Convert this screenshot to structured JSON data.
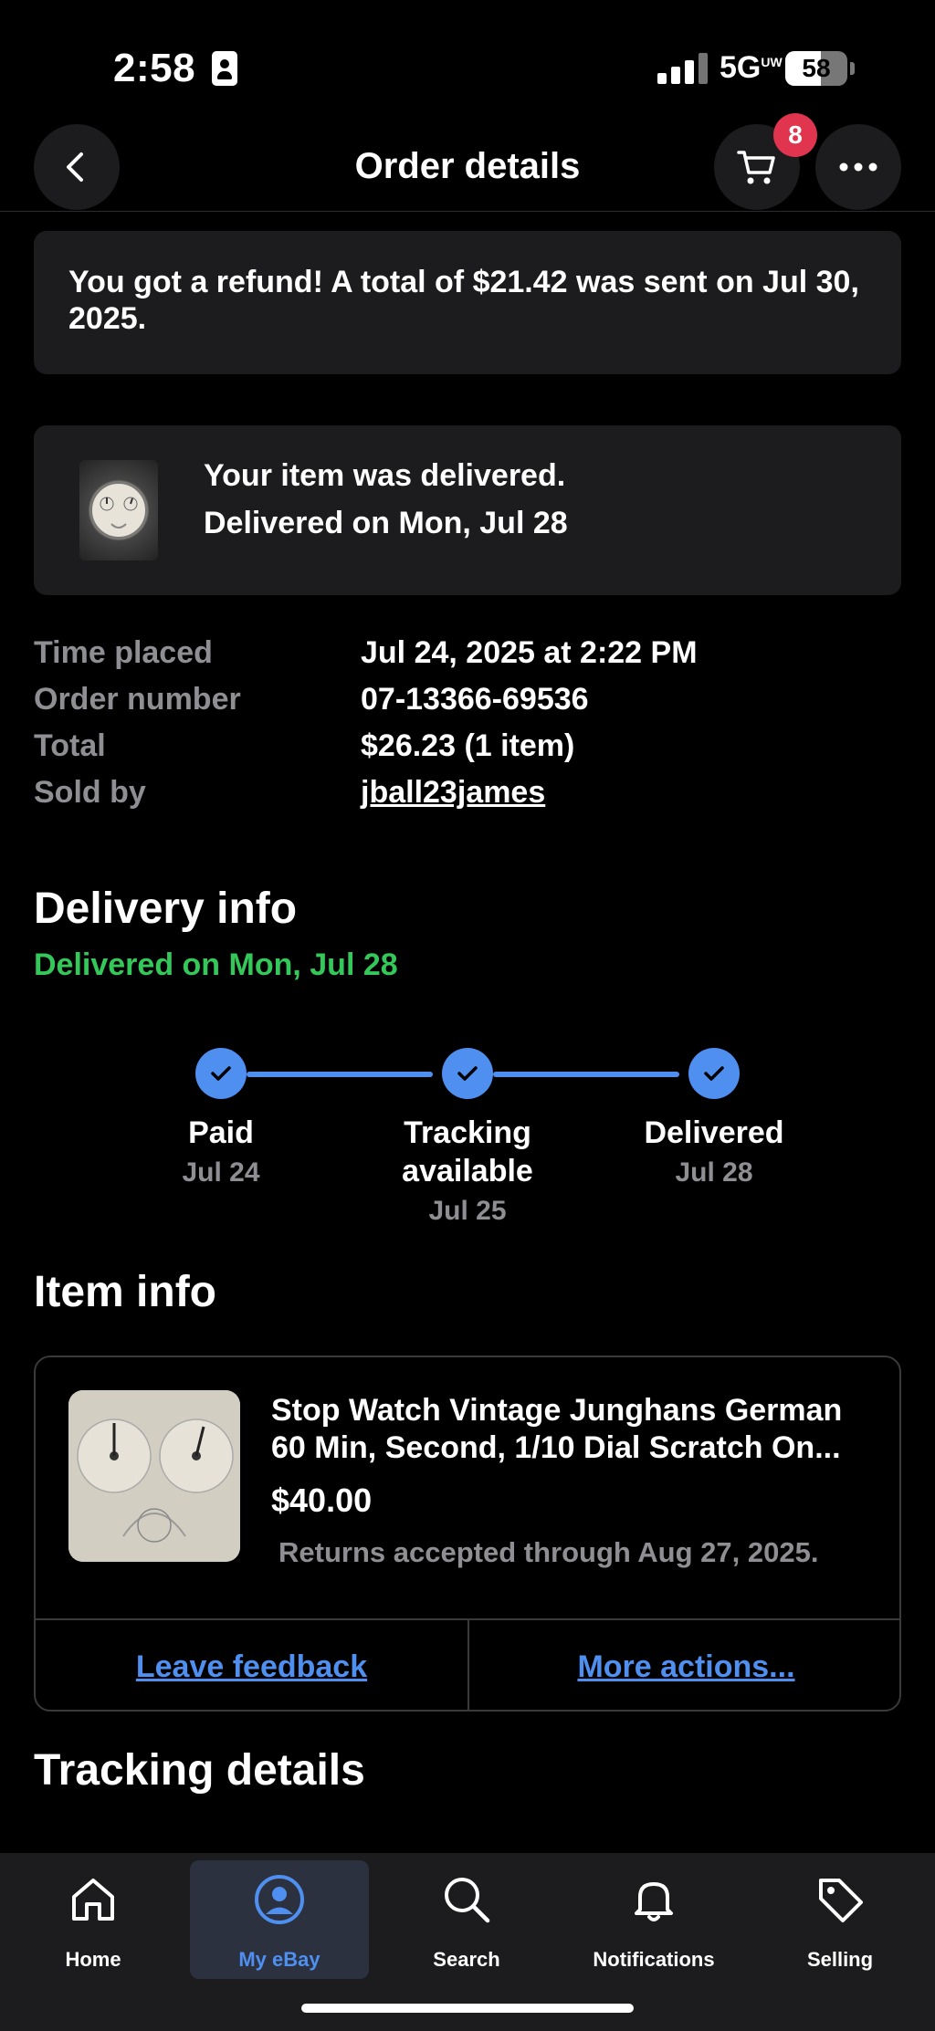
{
  "status_bar": {
    "time": "2:58",
    "network": "5G",
    "network_suffix": "UW",
    "battery": "58"
  },
  "header": {
    "title": "Order details",
    "cart_count": "8"
  },
  "refund": {
    "message": "You got a refund! A total of $21.42 was sent on Jul 30, 2025."
  },
  "delivered_card": {
    "line1": "Your item was delivered.",
    "line2": "Delivered on Mon, Jul 28"
  },
  "details": [
    {
      "label": "Time placed",
      "value": "Jul 24, 2025 at 2:22 PM"
    },
    {
      "label": "Order number",
      "value": "07-13366-69536"
    },
    {
      "label": "Total",
      "value": "$26.23 (1 item)"
    },
    {
      "label": "Sold by",
      "value": "jball23james"
    }
  ],
  "delivery_info": {
    "title": "Delivery info",
    "status": "Delivered on Mon, Jul 28",
    "steps": [
      {
        "label": "Paid",
        "date": "Jul 24"
      },
      {
        "label": "Tracking available",
        "date": "Jul 25"
      },
      {
        "label": "Delivered",
        "date": "Jul 28"
      }
    ]
  },
  "item_info": {
    "title": "Item info",
    "item_title": "Stop Watch Vintage Junghans German 60 Min, Second, 1/10 Dial Scratch On...",
    "price": "$40.00",
    "returns": "Returns accepted through Aug 27, 2025.",
    "leave_feedback": "Leave feedback",
    "more_actions": "More actions..."
  },
  "tracking": {
    "title": "Tracking details"
  },
  "nav": [
    {
      "label": "Home",
      "icon": "home-icon"
    },
    {
      "label": "My eBay",
      "icon": "account-icon"
    },
    {
      "label": "Search",
      "icon": "search-icon"
    },
    {
      "label": "Notifications",
      "icon": "bell-icon"
    },
    {
      "label": "Selling",
      "icon": "tag-icon"
    }
  ],
  "colors": {
    "accent": "#4f8ff0",
    "success": "#34c759",
    "badge": "#e0344f",
    "card": "#1c1c1e"
  }
}
